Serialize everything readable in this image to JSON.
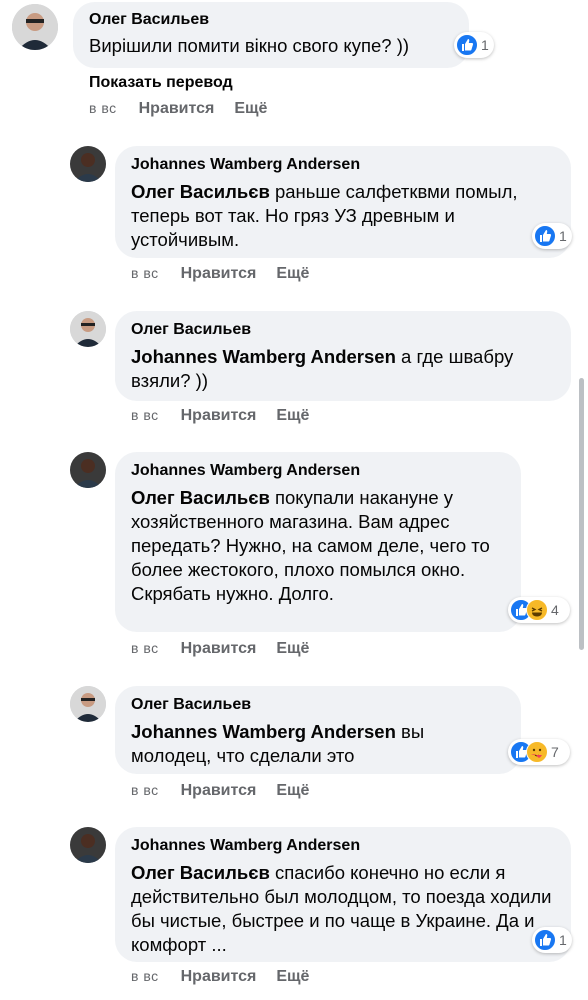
{
  "comments": [
    {
      "author": "Олег Васильев",
      "text": "Вирішили помити вікно свого купе? ))",
      "reaction_count": "1",
      "time": "в вс",
      "like_label": "Нравится",
      "more_label": "Ещё"
    },
    {
      "author": "Johannes Wamberg Andersen",
      "mention": "Олег Васильєв",
      "text": " раньше салфетквми помыл, теперь вот так. Но гряз УЗ древным и устойчивым.",
      "reaction_count": "1",
      "time": "в вс",
      "like_label": "Нравится",
      "more_label": "Ещё"
    },
    {
      "author": "Олег Васильев",
      "mention": "Johannes Wamberg Andersen",
      "text": " а где швабру взяли? ))",
      "time": "в вс",
      "like_label": "Нравится",
      "more_label": "Ещё"
    },
    {
      "author": "Johannes Wamberg Andersen",
      "mention": "Олег Васильєв",
      "text": " покупали накануне у хозяйственного магазина. Вам адрес передать? Нужно, на самом деле, чего то более жестокого, плохо помылся окно. Скрябать нужно. Долго.",
      "reaction_count": "4",
      "time": "в вс",
      "like_label": "Нравится",
      "more_label": "Ещё"
    },
    {
      "author": "Олег Васильев",
      "mention": "Johannes Wamberg Andersen",
      "text": " вы молодец, что сделали это",
      "reaction_count": "7",
      "time": "в вс",
      "like_label": "Нравится",
      "more_label": "Ещё"
    },
    {
      "author": "Johannes Wamberg Andersen",
      "mention": "Олег Васильєв",
      "text": " спасибо конечно но если я действительно был молодцом, то поезда ходили бы чистые, быстрее и по чаще в Украине. Да и комфорт ...",
      "reaction_count": "1",
      "time": "в вс",
      "like_label": "Нравится",
      "more_label": "Ещё"
    }
  ],
  "translate_label": "Показать перевод",
  "colors": {
    "bubble": "#f0f2f5",
    "like_blue": "#1877f2",
    "meta_gray": "#65676b"
  },
  "icons": [
    "like-icon",
    "haha-icon",
    "care-icon",
    "avatar"
  ]
}
